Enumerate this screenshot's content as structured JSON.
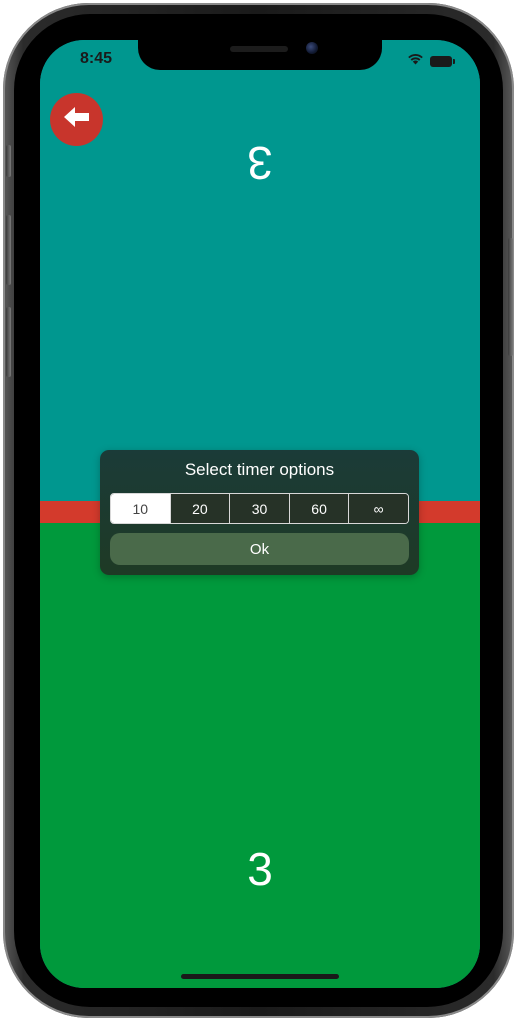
{
  "status_bar": {
    "time": "8:45",
    "icons": [
      "wifi-icon",
      "battery-icon"
    ]
  },
  "back_button": {
    "icon": "arrow-left-icon",
    "color": "#c8352c"
  },
  "player_top": {
    "count": "3",
    "background": "#00978f",
    "orientation": "rotated-180"
  },
  "divider": {
    "color": "#d33a2c"
  },
  "player_bottom": {
    "count": "3",
    "background": "#00993c"
  },
  "timer_dialog": {
    "title": "Select timer options",
    "options": [
      "10",
      "20",
      "30",
      "60",
      "∞"
    ],
    "selected": "10",
    "ok_label": "Ok"
  }
}
